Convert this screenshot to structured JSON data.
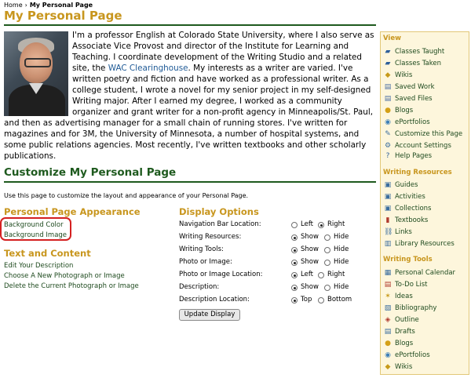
{
  "breadcrumb": {
    "home": "Home",
    "separator": "›",
    "current": "My Personal Page"
  },
  "page_title": "My Personal Page",
  "bio": {
    "text_before_link": "I'm a professor English at Colorado State University, where I also serve as Associate Vice Provost and director of the Institute for Learning and Teaching. I coordinate development of the Writing Studio and a related site, the ",
    "link_text": "WAC Clearinghouse",
    "text_after_link": ". My interests as a writer are varied. I've written poetry and fiction and have worked as a professional writer. As a college student, I wrote a novel for my senior project in my self-designed Writing major. After I earned my degree, I worked as a community organizer and grant writer for a non-profit agency in Minneapolis/St. Paul, and then as advertising manager for a small chain of running stores. I've written for magazines and for 3M, the University of Minnesota, a number of hospital systems, and some public relations agencies. Most recently, I've written textbooks and other scholarly publications."
  },
  "customize": {
    "title": "Customize My Personal Page",
    "intro": "Use this page to customize the layout and appearance of your Personal Page.",
    "appearance": {
      "heading": "Personal Page Appearance",
      "links": [
        "Background Color",
        "Background Image"
      ]
    },
    "content": {
      "heading": "Text and Content",
      "links": [
        "Edit Your Description",
        "Choose A New Photograph or Image",
        "Delete the Current Photograph or Image"
      ]
    },
    "display": {
      "heading": "Display Options",
      "options": [
        {
          "label": "Navigation Bar Location:",
          "choices": [
            "Left",
            "Right"
          ],
          "selected": 1
        },
        {
          "label": "Writing Resources:",
          "choices": [
            "Show",
            "Hide"
          ],
          "selected": 0
        },
        {
          "label": "Writing Tools:",
          "choices": [
            "Show",
            "Hide"
          ],
          "selected": 0
        },
        {
          "label": "Photo or Image:",
          "choices": [
            "Show",
            "Hide"
          ],
          "selected": 0
        },
        {
          "label": "Photo or Image Location:",
          "choices": [
            "Left",
            "Right"
          ],
          "selected": 0
        },
        {
          "label": "Description:",
          "choices": [
            "Show",
            "Hide"
          ],
          "selected": 0
        },
        {
          "label": "Description Location:",
          "choices": [
            "Top",
            "Bottom"
          ],
          "selected": 0
        }
      ],
      "button": "Update Display"
    }
  },
  "sidebar": {
    "sections": [
      {
        "heading": "View",
        "items": [
          {
            "label": "Classes Taught",
            "icon": "class-icon"
          },
          {
            "label": "Classes Taken",
            "icon": "class-icon"
          },
          {
            "label": "Wikis",
            "icon": "wiki-icon"
          },
          {
            "label": "Saved Work",
            "icon": "saved-work-icon"
          },
          {
            "label": "Saved Files",
            "icon": "saved-files-icon"
          },
          {
            "label": "Blogs",
            "icon": "blog-icon"
          },
          {
            "label": "ePortfolios",
            "icon": "eportfolio-icon"
          },
          {
            "label": "Customize this Page",
            "icon": "customize-icon"
          },
          {
            "label": "Account Settings",
            "icon": "settings-icon"
          },
          {
            "label": "Help Pages",
            "icon": "help-icon"
          }
        ]
      },
      {
        "heading": "Writing Resources",
        "items": [
          {
            "label": "Guides",
            "icon": "guide-icon"
          },
          {
            "label": "Activities",
            "icon": "activity-icon"
          },
          {
            "label": "Collections",
            "icon": "collection-icon"
          },
          {
            "label": "Textbooks",
            "icon": "textbook-icon"
          },
          {
            "label": "Links",
            "icon": "link-icon"
          },
          {
            "label": "Library Resources",
            "icon": "library-icon"
          }
        ]
      },
      {
        "heading": "Writing Tools",
        "items": [
          {
            "label": "Personal Calendar",
            "icon": "calendar-icon"
          },
          {
            "label": "To-Do List",
            "icon": "todo-icon"
          },
          {
            "label": "Ideas",
            "icon": "idea-icon"
          },
          {
            "label": "Bibliography",
            "icon": "bibliography-icon"
          },
          {
            "label": "Outline",
            "icon": "outline-icon"
          },
          {
            "label": "Drafts",
            "icon": "draft-icon"
          },
          {
            "label": "Blogs",
            "icon": "blog-icon"
          },
          {
            "label": "ePortfolios",
            "icon": "eportfolio-icon"
          },
          {
            "label": "Wikis",
            "icon": "wiki-icon"
          }
        ]
      }
    ]
  },
  "colors": {
    "accent_gold": "#c8961e",
    "heading_green": "#1e5a1e",
    "link_blue": "#1f5a96",
    "sidebar_bg": "#fdf6dc",
    "highlight_red": "#d42020"
  }
}
